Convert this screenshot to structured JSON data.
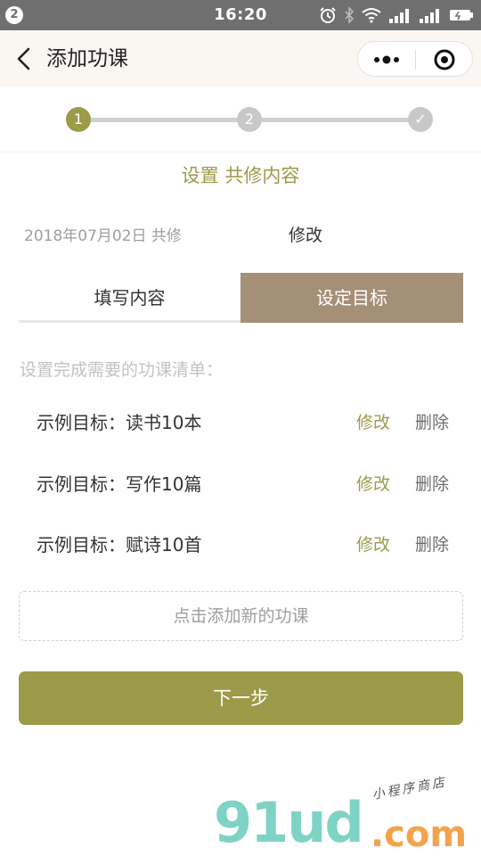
{
  "status_bar": {
    "badge": "2",
    "time": "16:20"
  },
  "nav": {
    "title": "添加功课"
  },
  "stepper": {
    "steps": [
      "1",
      "2",
      "✓"
    ],
    "active_index": 0
  },
  "section_title": "设置 共修内容",
  "date_row": {
    "text": "2018年07月02日 共修",
    "edit_label": "修改"
  },
  "tabs": [
    {
      "label": "填写内容",
      "active": false
    },
    {
      "label": "设定目标",
      "active": true
    }
  ],
  "list_hint": "设置完成需要的功课清单：",
  "goals": [
    {
      "label": "示例目标：读书10本",
      "edit": "修改",
      "delete": "删除"
    },
    {
      "label": "示例目标：写作10篇",
      "edit": "修改",
      "delete": "删除"
    },
    {
      "label": "示例目标：赋诗10首",
      "edit": "修改",
      "delete": "删除"
    }
  ],
  "add_button": "点击添加新的功课",
  "next_button": "下一步",
  "watermark": {
    "main": "91ud",
    "suffix": ".com",
    "tagline": "小程序商店"
  },
  "colors": {
    "accent": "#9b9b4a",
    "tab_active": "#a48f77",
    "status_bar": "#6f6f6f",
    "nav_bg": "#faf7f2"
  },
  "icons": {
    "back": "back-arrow-icon",
    "more": "more-dots-icon",
    "close": "target-close-icon"
  }
}
